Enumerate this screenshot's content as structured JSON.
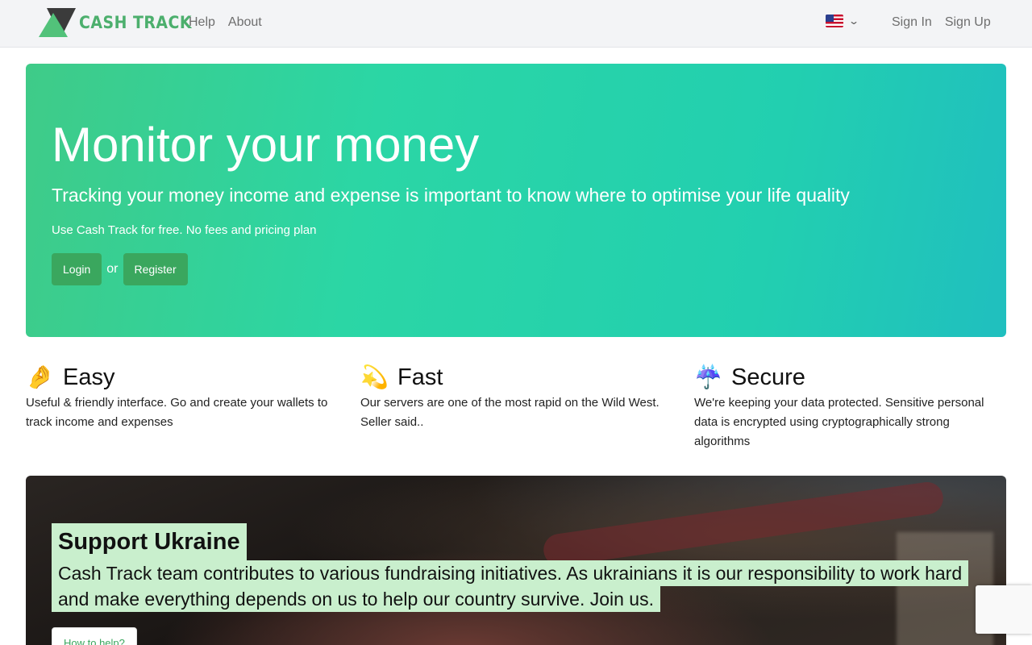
{
  "brand": {
    "name": "CASH TRACK",
    "colors": {
      "primary": "#4caf6d",
      "dark": "#333333"
    }
  },
  "nav": {
    "links": [
      "Help",
      "About"
    ],
    "language": {
      "icon": "us-flag-icon",
      "dropdown_icon": "chevron-down-icon"
    },
    "auth": {
      "sign_in": "Sign In",
      "sign_up": "Sign Up"
    }
  },
  "hero": {
    "title": "Monitor your money",
    "lead": "Tracking your money income and expense is important to know where to optimise your life quality",
    "note": "Use Cash Track for free. No fees and pricing plan",
    "login_label": "Login",
    "or_label": "or",
    "register_label": "Register",
    "gradient": [
      "#3fcb88",
      "#20bfbf"
    ]
  },
  "features": [
    {
      "emoji": "🤌",
      "icon": "pinched-fingers-icon",
      "title": "Easy",
      "text": "Useful & friendly interface. Go and create your wallets to track income and expenses"
    },
    {
      "emoji": "💫",
      "icon": "dizzy-star-icon",
      "title": "Fast",
      "text": "Our servers are one of the most rapid on the Wild West. Seller said.."
    },
    {
      "emoji": "☔️",
      "icon": "umbrella-icon",
      "title": "Secure",
      "text": "We're keeping your data protected. Sensitive personal data is encrypted using cryptographically strong algorithms"
    }
  ],
  "ukraine": {
    "title": "Support Ukraine",
    "text": "Cash Track team contributes to various fundraising initiatives. As ukrainians it is our responsibility to work hard and make everything depends on us to help our country survive. Join us.",
    "button_label": "How to help?",
    "highlight_color": "#c9efcd"
  }
}
